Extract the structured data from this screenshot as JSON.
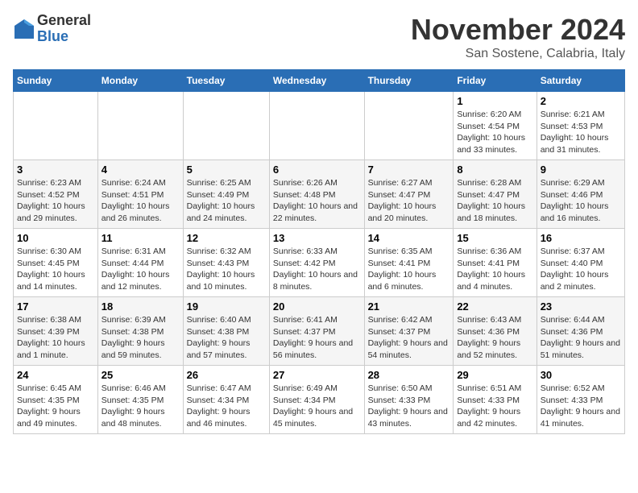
{
  "logo": {
    "general": "General",
    "blue": "Blue"
  },
  "title": "November 2024",
  "location": "San Sostene, Calabria, Italy",
  "headers": [
    "Sunday",
    "Monday",
    "Tuesday",
    "Wednesday",
    "Thursday",
    "Friday",
    "Saturday"
  ],
  "rows": [
    [
      {
        "day": "",
        "info": ""
      },
      {
        "day": "",
        "info": ""
      },
      {
        "day": "",
        "info": ""
      },
      {
        "day": "",
        "info": ""
      },
      {
        "day": "",
        "info": ""
      },
      {
        "day": "1",
        "info": "Sunrise: 6:20 AM\nSunset: 4:54 PM\nDaylight: 10 hours and 33 minutes."
      },
      {
        "day": "2",
        "info": "Sunrise: 6:21 AM\nSunset: 4:53 PM\nDaylight: 10 hours and 31 minutes."
      }
    ],
    [
      {
        "day": "3",
        "info": "Sunrise: 6:23 AM\nSunset: 4:52 PM\nDaylight: 10 hours and 29 minutes."
      },
      {
        "day": "4",
        "info": "Sunrise: 6:24 AM\nSunset: 4:51 PM\nDaylight: 10 hours and 26 minutes."
      },
      {
        "day": "5",
        "info": "Sunrise: 6:25 AM\nSunset: 4:49 PM\nDaylight: 10 hours and 24 minutes."
      },
      {
        "day": "6",
        "info": "Sunrise: 6:26 AM\nSunset: 4:48 PM\nDaylight: 10 hours and 22 minutes."
      },
      {
        "day": "7",
        "info": "Sunrise: 6:27 AM\nSunset: 4:47 PM\nDaylight: 10 hours and 20 minutes."
      },
      {
        "day": "8",
        "info": "Sunrise: 6:28 AM\nSunset: 4:47 PM\nDaylight: 10 hours and 18 minutes."
      },
      {
        "day": "9",
        "info": "Sunrise: 6:29 AM\nSunset: 4:46 PM\nDaylight: 10 hours and 16 minutes."
      }
    ],
    [
      {
        "day": "10",
        "info": "Sunrise: 6:30 AM\nSunset: 4:45 PM\nDaylight: 10 hours and 14 minutes."
      },
      {
        "day": "11",
        "info": "Sunrise: 6:31 AM\nSunset: 4:44 PM\nDaylight: 10 hours and 12 minutes."
      },
      {
        "day": "12",
        "info": "Sunrise: 6:32 AM\nSunset: 4:43 PM\nDaylight: 10 hours and 10 minutes."
      },
      {
        "day": "13",
        "info": "Sunrise: 6:33 AM\nSunset: 4:42 PM\nDaylight: 10 hours and 8 minutes."
      },
      {
        "day": "14",
        "info": "Sunrise: 6:35 AM\nSunset: 4:41 PM\nDaylight: 10 hours and 6 minutes."
      },
      {
        "day": "15",
        "info": "Sunrise: 6:36 AM\nSunset: 4:41 PM\nDaylight: 10 hours and 4 minutes."
      },
      {
        "day": "16",
        "info": "Sunrise: 6:37 AM\nSunset: 4:40 PM\nDaylight: 10 hours and 2 minutes."
      }
    ],
    [
      {
        "day": "17",
        "info": "Sunrise: 6:38 AM\nSunset: 4:39 PM\nDaylight: 10 hours and 1 minute."
      },
      {
        "day": "18",
        "info": "Sunrise: 6:39 AM\nSunset: 4:38 PM\nDaylight: 9 hours and 59 minutes."
      },
      {
        "day": "19",
        "info": "Sunrise: 6:40 AM\nSunset: 4:38 PM\nDaylight: 9 hours and 57 minutes."
      },
      {
        "day": "20",
        "info": "Sunrise: 6:41 AM\nSunset: 4:37 PM\nDaylight: 9 hours and 56 minutes."
      },
      {
        "day": "21",
        "info": "Sunrise: 6:42 AM\nSunset: 4:37 PM\nDaylight: 9 hours and 54 minutes."
      },
      {
        "day": "22",
        "info": "Sunrise: 6:43 AM\nSunset: 4:36 PM\nDaylight: 9 hours and 52 minutes."
      },
      {
        "day": "23",
        "info": "Sunrise: 6:44 AM\nSunset: 4:36 PM\nDaylight: 9 hours and 51 minutes."
      }
    ],
    [
      {
        "day": "24",
        "info": "Sunrise: 6:45 AM\nSunset: 4:35 PM\nDaylight: 9 hours and 49 minutes."
      },
      {
        "day": "25",
        "info": "Sunrise: 6:46 AM\nSunset: 4:35 PM\nDaylight: 9 hours and 48 minutes."
      },
      {
        "day": "26",
        "info": "Sunrise: 6:47 AM\nSunset: 4:34 PM\nDaylight: 9 hours and 46 minutes."
      },
      {
        "day": "27",
        "info": "Sunrise: 6:49 AM\nSunset: 4:34 PM\nDaylight: 9 hours and 45 minutes."
      },
      {
        "day": "28",
        "info": "Sunrise: 6:50 AM\nSunset: 4:33 PM\nDaylight: 9 hours and 43 minutes."
      },
      {
        "day": "29",
        "info": "Sunrise: 6:51 AM\nSunset: 4:33 PM\nDaylight: 9 hours and 42 minutes."
      },
      {
        "day": "30",
        "info": "Sunrise: 6:52 AM\nSunset: 4:33 PM\nDaylight: 9 hours and 41 minutes."
      }
    ]
  ]
}
